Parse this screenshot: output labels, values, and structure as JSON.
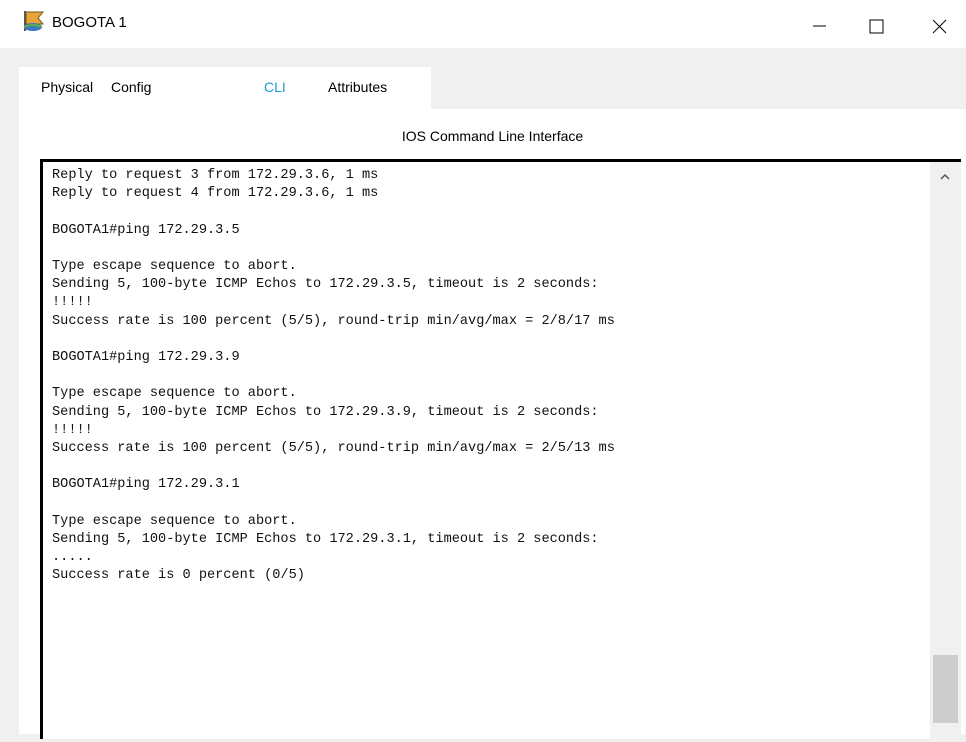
{
  "window": {
    "title": "BOGOTA 1",
    "icon": "router-icon",
    "controls": [
      "minimize-icon",
      "maximize-icon",
      "close-icon"
    ]
  },
  "tabs": [
    {
      "label": "Physical",
      "active": false
    },
    {
      "label": "Config",
      "active": false
    },
    {
      "label": "CLI",
      "active": true
    },
    {
      "label": "Attributes",
      "active": false
    }
  ],
  "panel": {
    "header": "IOS Command Line Interface"
  },
  "console": {
    "lines": [
      "Reply to request 3 from 172.29.3.6, 1 ms",
      "Reply to request 4 from 172.29.3.6, 1 ms",
      "",
      "BOGOTA1#ping 172.29.3.5",
      "",
      "Type escape sequence to abort.",
      "Sending 5, 100-byte ICMP Echos to 172.29.3.5, timeout is 2 seconds:",
      "!!!!!",
      "Success rate is 100 percent (5/5), round-trip min/avg/max = 2/8/17 ms",
      "",
      "BOGOTA1#ping 172.29.3.9",
      "",
      "Type escape sequence to abort.",
      "Sending 5, 100-byte ICMP Echos to 172.29.3.9, timeout is 2 seconds:",
      "!!!!!",
      "Success rate is 100 percent (5/5), round-trip min/avg/max = 2/5/13 ms",
      "",
      "BOGOTA1#ping 172.29.3.1",
      "",
      "Type escape sequence to abort.",
      "Sending 5, 100-byte ICMP Echos to 172.29.3.1, timeout is 2 seconds:",
      ".....",
      "Success rate is 0 percent (0/5)"
    ]
  },
  "colors": {
    "accent": "#1a9bd7",
    "background": "#f0f0f0"
  }
}
